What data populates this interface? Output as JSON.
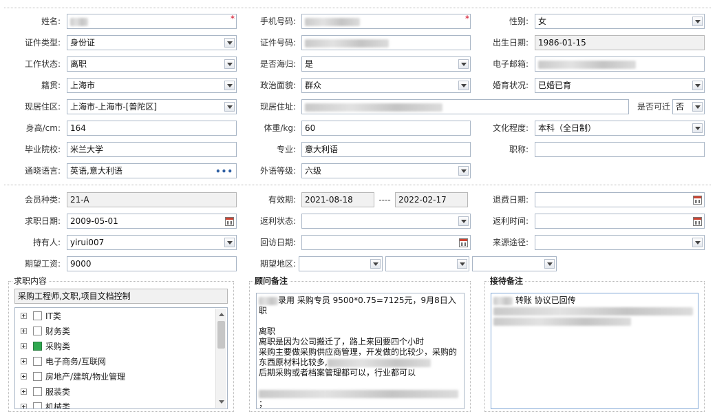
{
  "personal": {
    "name_label": "姓名:",
    "mobile_label": "手机号码:",
    "gender_label": "性别:",
    "gender_value": "女",
    "id_type_label": "证件类型:",
    "id_type_value": "身份证",
    "id_number_label": "证件号码:",
    "birth_label": "出生日期:",
    "birth_value": "1986-01-15",
    "work_status_label": "工作状态:",
    "work_status_value": "离职",
    "returnee_label": "是否海归:",
    "returnee_value": "是",
    "email_label": "电子邮箱:",
    "native_label": "籍贯:",
    "native_value": "上海市",
    "political_label": "政治面貌:",
    "political_value": "群众",
    "marital_label": "婚育状况:",
    "marital_value": "已婚已育",
    "region_label": "现居住区:",
    "region_value": "上海市-上海市-[普陀区]",
    "address_label": "现居住址:",
    "relocate_label": "是否可迁",
    "relocate_value": "否",
    "height_label": "身高/cm:",
    "height_value": "164",
    "weight_label": "体重/kg:",
    "weight_value": "60",
    "education_label": "文化程度:",
    "education_value": "本科（全日制）",
    "school_label": "毕业院校:",
    "school_value": "米兰大学",
    "major_label": "专业:",
    "major_value": "意大利语",
    "title_label": "职称:",
    "title_value": "",
    "language_label": "通晓语言:",
    "language_value": "英语,意大利语",
    "lang_level_label": "外语等级:",
    "lang_level_value": "六级"
  },
  "membership": {
    "member_type_label": "会员种类:",
    "member_type_value": "21-A",
    "validity_label": "有效期:",
    "validity_from": "2021-08-18",
    "validity_sep": "----",
    "validity_to": "2022-02-17",
    "refund_date_label": "退费日期:",
    "job_date_label": "求职日期:",
    "job_date_value": "2009-05-01",
    "rebate_status_label": "返利状态:",
    "rebate_time_label": "返利时间:",
    "holder_label": "持有人:",
    "holder_value": "yirui007",
    "revisit_label": "回访日期:",
    "source_label": "来源途径:",
    "salary_label": "期望工资:",
    "salary_value": "9000",
    "area_label": "期望地区:"
  },
  "job_content": {
    "legend": "求职内容",
    "summary": "采购工程师,文职,项目文档控制",
    "categories": [
      {
        "label": "IT类",
        "checked": false
      },
      {
        "label": "财务类",
        "checked": false
      },
      {
        "label": "采购类",
        "checked": true
      },
      {
        "label": "电子商务/互联网",
        "checked": false
      },
      {
        "label": "房地产/建筑/物业管理",
        "checked": false
      },
      {
        "label": "服装类",
        "checked": false
      },
      {
        "label": "机械类",
        "checked": false
      }
    ]
  },
  "advisor_notes": {
    "legend": "顾问备注",
    "line1": "录用 采购专员 9500*0.75=7125元，9月8日入职",
    "line2": "离职",
    "line3": "离职是因为公司搬迁了，路上来回要四个小时",
    "line4": "采购主要做采购供应商管理，开发做的比较少，采购的",
    "line5": "东西原材料比较多,",
    "line6": "后期采购或者档案管理都可以，行业都可以",
    "line7": "；"
  },
  "reception_notes": {
    "legend": "接待备注",
    "line1": "转账 协议已回传"
  },
  "colors": {
    "field_border": "#a9b6c6",
    "readonly_bg": "#f1f1f1",
    "required_star": "#d0021b",
    "checked_green": "#2fa84f"
  }
}
